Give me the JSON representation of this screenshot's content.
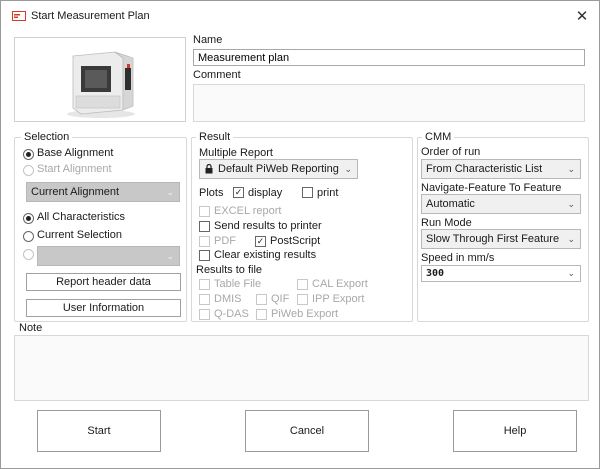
{
  "window": {
    "title": "Start Measurement Plan",
    "close_glyph": "✕"
  },
  "name": {
    "label": "Name",
    "value": "Measurement plan"
  },
  "comment": {
    "label": "Comment",
    "value": ""
  },
  "selection": {
    "title": "Selection",
    "base_alignment": "Base Alignment",
    "start_alignment": "Start Alignment",
    "alignment_select": "Current Alignment",
    "all_characteristics": "All Characteristics",
    "current_selection": "Current Selection",
    "third_select": "",
    "report_header_button": "Report header data",
    "user_info_button": "User Information"
  },
  "result": {
    "title": "Result",
    "multiple_report_label": "Multiple Report",
    "multiple_report_value": "Default PiWeb Reporting",
    "plots_label": "Plots",
    "display_label": "display",
    "print_label": "print",
    "excel_report": "EXCEL report",
    "send_to_printer": "Send results to printer",
    "pdf": "PDF",
    "postscript": "PostScript",
    "clear_existing": "Clear existing results",
    "results_to_file": "Results to file",
    "table_file": "Table File",
    "cal_export": "CAL Export",
    "dmis": "DMIS",
    "qif": "QIF",
    "ipp_export": "IPP Export",
    "qdas": "Q-DAS",
    "piweb_export": "PiWeb Export"
  },
  "cmm": {
    "title": "CMM",
    "order_label": "Order of run",
    "order_value": "From Characteristic List",
    "navigate_label": "Navigate-Feature To Feature",
    "navigate_value": "Automatic",
    "run_mode_label": "Run Mode",
    "run_mode_value": "Slow Through First Feature",
    "speed_label": "Speed in mm/s",
    "speed_value": "300"
  },
  "note": {
    "label": "Note",
    "value": ""
  },
  "buttons": {
    "start": "Start",
    "cancel": "Cancel",
    "help": "Help"
  },
  "state": {
    "base_alignment_checked": true,
    "all_characteristics_checked": true,
    "display_checked": true,
    "print_checked": false,
    "postscript_checked": true
  },
  "icons": {
    "app": "measurement-plan-icon",
    "lock": "lock-icon",
    "dropdown": "chevron-down-icon",
    "machine": "cmm-machine-image"
  },
  "colors": {
    "border": "#d0d0d0",
    "disabled_text": "#a8a8a8",
    "gray_select": "#c8c8c8",
    "icon_red": "#d03a2a"
  }
}
